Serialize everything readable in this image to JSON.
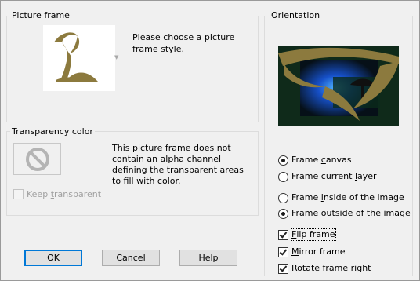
{
  "picture_frame": {
    "title": "Picture frame",
    "description": "Please choose a picture frame style."
  },
  "transparency": {
    "title": "Transparency color",
    "description": "This picture frame does not contain an alpha channel defining the transparent areas to fill with color.",
    "keep_transparent": {
      "label_pre": "Keep ",
      "label_ul": "t",
      "label_post": "ransparent",
      "checked": false,
      "enabled": false
    }
  },
  "orientation": {
    "title": "Orientation",
    "frame_canvas": {
      "pre": "Frame ",
      "ul": "c",
      "post": "anvas",
      "selected": true
    },
    "frame_current_layer": {
      "pre": "Frame current ",
      "ul": "l",
      "post": "ayer",
      "selected": false
    },
    "frame_inside": {
      "pre": "Frame ",
      "ul": "i",
      "post": "nside of the image",
      "selected": false
    },
    "frame_outside": {
      "pre": "Frame ",
      "ul": "o",
      "post": "utside of the image",
      "selected": true
    },
    "flip_frame": {
      "pre": "",
      "ul": "F",
      "post": "lip frame",
      "checked": true
    },
    "mirror_frame": {
      "pre": "",
      "ul": "M",
      "post": "irror frame",
      "checked": true
    },
    "rotate_frame_right": {
      "pre": "",
      "ul": "R",
      "post": "otate frame right",
      "checked": true
    }
  },
  "buttons": {
    "ok": "OK",
    "cancel": "Cancel",
    "help": "Help"
  },
  "colors": {
    "frame_gold": "#8c7a3e",
    "default_button_border": "#0078d7"
  }
}
